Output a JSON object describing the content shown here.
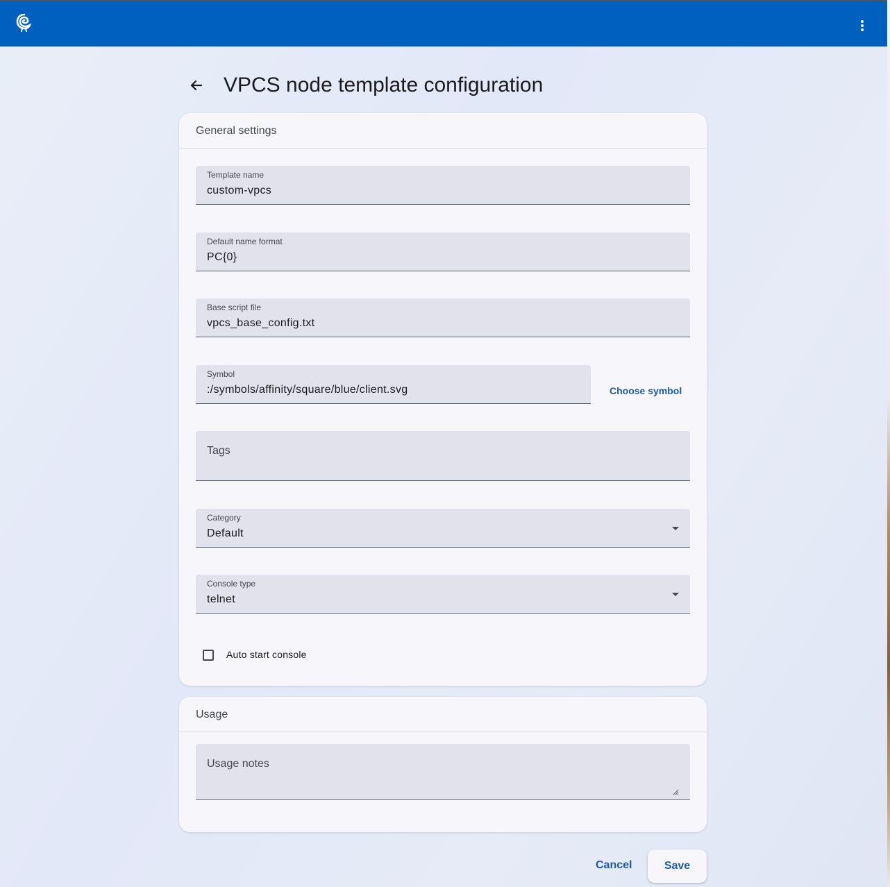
{
  "header": {
    "logo_icon": "gns3-chameleon-logo-icon",
    "menu_icon": "more-vert-icon",
    "background_color": "#0060c0"
  },
  "page": {
    "back_icon": "arrow-back-icon",
    "title": "VPCS node template configuration"
  },
  "general_settings": {
    "title": "General settings",
    "template_name": {
      "label": "Template name",
      "value": "custom-vpcs"
    },
    "default_name_format": {
      "label": "Default name format",
      "value": "PC{0}"
    },
    "base_script_file": {
      "label": "Base script file",
      "value": "vpcs_base_config.txt"
    },
    "symbol": {
      "label": "Symbol",
      "value": ":/symbols/affinity/square/blue/client.svg"
    },
    "choose_symbol_label": "Choose symbol",
    "tags": {
      "placeholder": "Tags"
    },
    "category": {
      "label": "Category",
      "value": "Default"
    },
    "console_type": {
      "label": "Console type",
      "value": "telnet"
    },
    "auto_start_console": {
      "label": "Auto start console",
      "checked": false
    }
  },
  "usage": {
    "title": "Usage",
    "usage_notes": {
      "placeholder": "Usage notes"
    }
  },
  "actions": {
    "cancel_label": "Cancel",
    "save_label": "Save"
  },
  "colors": {
    "accent_text": "#1f5ba5",
    "field_bg": "#e1e2ec",
    "card_bg": "#f7f7fb"
  }
}
